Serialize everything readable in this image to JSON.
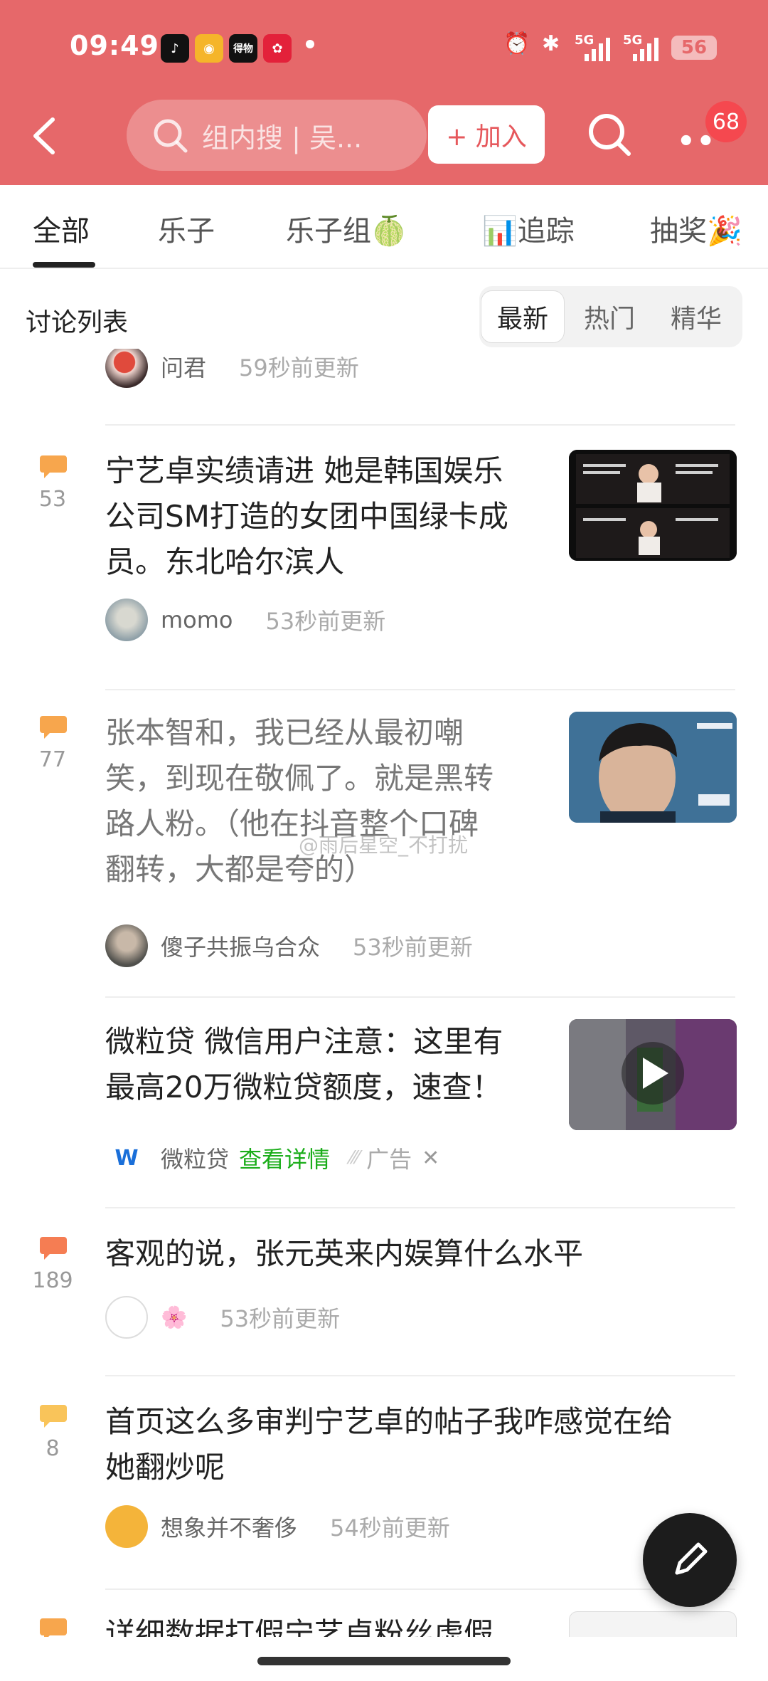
{
  "status": {
    "time": "09:49",
    "apps": [
      {
        "name": "douyin-app-icon",
        "glyph": "♪",
        "color": "#111111"
      },
      {
        "name": "weibo-app-icon",
        "glyph": "◉",
        "color": "#f5b52a"
      },
      {
        "name": "dewu-app-icon",
        "glyph": "得物",
        "color": "#111111"
      },
      {
        "name": "pinduoduo-app-icon",
        "glyph": "✿",
        "color": "#e3213a"
      }
    ],
    "alarm": "⏰",
    "bluetooth": "✱",
    "signal1": "5G",
    "signal2": "5G",
    "battery": "56"
  },
  "header": {
    "search_placeholder": "组内搜 | 吴...",
    "join_label": "+ 加入",
    "more_label": "••",
    "badge_count": "68"
  },
  "tabs": [
    "全部",
    "乐子",
    "乐子组🍈",
    "📊追踪",
    "抽奖🎉"
  ],
  "list": {
    "title": "讨论列表",
    "sort_options": [
      "最新",
      "热门",
      "精华"
    ],
    "active_sort": "最新"
  },
  "watermark": "@雨后星空_不打扰",
  "partial_top": {
    "author": "问君",
    "time": "59秒前更新"
  },
  "posts": [
    {
      "comments": "53",
      "title_lines": [
        "宁艺卓实绩请进 她是韩国娱乐",
        "公司SM打造的女团中国绿卡成",
        "员。东北哈尔滨人"
      ],
      "author": "momo",
      "time": "53秒前更新"
    },
    {
      "comments": "77",
      "title_lines": [
        "张本智和，我已经从最初嘲",
        "笑，到现在敬佩了。就是黑转",
        "路人粉。（他在抖音整个口碑",
        "翻转，大都是夸的）"
      ],
      "author": "傻子共振乌合众",
      "time": "53秒前更新"
    },
    {
      "ad": true,
      "title_lines": [
        "微粒贷 微信用户注意：这里有",
        "最高20万微粒贷额度，速查！"
      ],
      "author": "微粒贷",
      "detail_link": "查看详情",
      "ad_label": "广告",
      "close": "✕"
    },
    {
      "comments": "189",
      "title_lines": [
        "客观的说，张元英来内娱算什么水平"
      ],
      "author": "🌸",
      "time": "53秒前更新"
    },
    {
      "comments": "8",
      "title_lines": [
        "首页这么多审判宁艺卓的帖子我咋感觉在给",
        "她翻炒呢"
      ],
      "author": "想象并不奢侈",
      "time": "54秒前更新"
    },
    {
      "comments": "",
      "title_lines": [
        "详细数据打假宁艺卓粉丝虚假"
      ],
      "author": "",
      "time": ""
    }
  ],
  "colors": {
    "header_red": "#e6686a",
    "comment_icon": "#f7a64d",
    "ad_link_green": "#1aad19"
  }
}
